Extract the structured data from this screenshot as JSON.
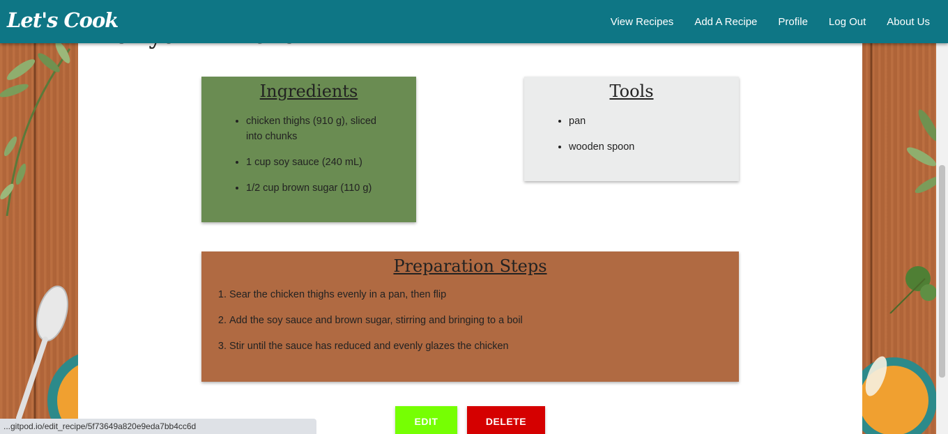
{
  "navbar": {
    "brand": "Let's Cook",
    "links": [
      "View Recipes",
      "Add A Recipe",
      "Profile",
      "Log Out",
      "About Us"
    ]
  },
  "recipe": {
    "title": "Teriyaki Chicken",
    "ingredients": {
      "heading": "Ingredients",
      "items": [
        "chicken thighs (910 g), sliced into chunks",
        "1 cup soy sauce (240 mL)",
        "1/2 cup brown sugar (110 g)"
      ]
    },
    "tools": {
      "heading": "Tools",
      "items": [
        "pan",
        "wooden spoon"
      ]
    },
    "steps": {
      "heading": "Preparation Steps",
      "items": [
        "Sear the chicken thighs evenly in a pan, then flip",
        "Add the soy sauce and brown sugar, stirring and bringing to a boil",
        "Stir until the sauce has reduced and evenly glazes the chicken"
      ]
    }
  },
  "buttons": {
    "edit": "EDIT",
    "delete": "DELETE"
  },
  "statusbar": {
    "url": "...gitpod.io/edit_recipe/5f73649a820e9eda7bb4cc6d"
  },
  "colors": {
    "navbar": "#0e7685",
    "ingredients_panel": "#6a8c52",
    "tools_panel": "#ebecec",
    "steps_panel": "#b06a42",
    "edit_button": "#76ff03",
    "delete_button": "#d50000"
  }
}
